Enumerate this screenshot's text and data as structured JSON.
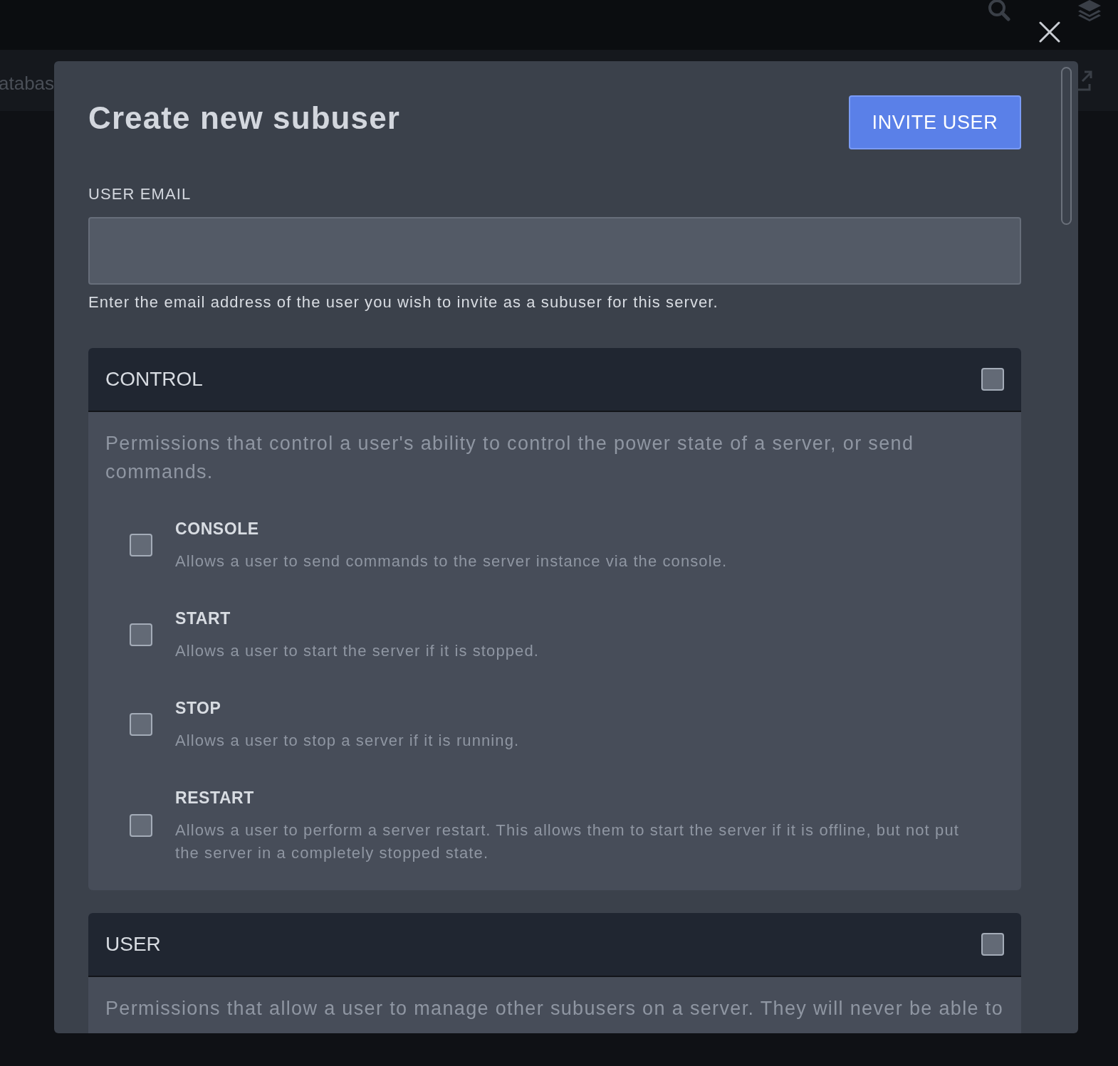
{
  "background": {
    "tab_text": "atabas"
  },
  "modal": {
    "title": "Create new subuser",
    "primary_button": "INVITE USER",
    "email_field": {
      "label": "USER EMAIL",
      "help": "Enter the email address of the user you wish to invite as a subuser for this server."
    },
    "groups": [
      {
        "name": "CONTROL",
        "checked": false,
        "description": "Permissions that control a user's ability to control the power state of a server, or send commands.",
        "permissions": [
          {
            "name": "CONSOLE",
            "checked": false,
            "description": "Allows a user to send commands to the server instance via the console."
          },
          {
            "name": "START",
            "checked": false,
            "description": "Allows a user to start the server if it is stopped."
          },
          {
            "name": "STOP",
            "checked": false,
            "description": "Allows a user to stop a server if it is running."
          },
          {
            "name": "RESTART",
            "checked": false,
            "description": "Allows a user to perform a server restart. This allows them to start the server if it is offline, but not put the server in a completely stopped state."
          }
        ]
      },
      {
        "name": "USER",
        "checked": false,
        "description": "Permissions that allow a user to manage other subusers on a server. They will never be able to"
      }
    ]
  }
}
